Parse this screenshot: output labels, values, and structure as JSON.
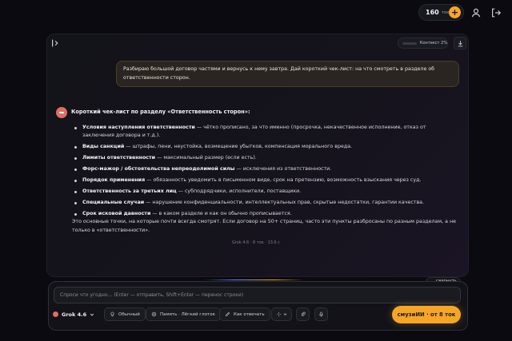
{
  "topbar": {
    "token_count": "160",
    "token_unit": "ток",
    "plus_label": "+"
  },
  "chat": {
    "context_label": "Контекст 2%",
    "user_message": "Разбираю большой договор частями и вернусь к нему завтра. Дай короткий чек-лист: на что смотреть в разделе об ответственности сторон.",
    "answer_title": "Короткий чек-лист по разделу «Ответственность сторон»:",
    "checklist": [
      {
        "term": "Условия наступления ответственности",
        "desc": " — чётко прописано, за что именно (просрочка, некачественное исполнение, отказ от заключения договора и т.д.)."
      },
      {
        "term": "Виды санкций",
        "desc": " — штрафы, пени, неустойка, возмещение убытков, компенсация морального вреда."
      },
      {
        "term": "Лимиты ответственности",
        "desc": " — максимальный размер (если есть)."
      },
      {
        "term": "Форс-мажор / обстоятельства непреодолимой силы",
        "desc": " — исключения из ответственности."
      },
      {
        "term": "Порядок применения",
        "desc": " — обязанность уведомить в письменном виде, срок на претензию, возможность взыскания через суд."
      },
      {
        "term": "Ответственность за третьих лиц",
        "desc": " — субподрядчики, исполнители, поставщики."
      },
      {
        "term": "Специальные случаи",
        "desc": " — нарушение конфиденциальности, интеллектуальных прав, скрытые недостатки, гарантии качества."
      },
      {
        "term": "Срок исковой давности",
        "desc": " — в каком разделе и как он обычно прописывается."
      }
    ],
    "answer_outro": "Это основные точки, на которые почти всегда смотрят. Если договор на 50+ страниц, часто эти пункты разбросаны по разным разделам, а не только в «ответственности».",
    "meta": "Grok 4.6 · 8 ток · 13.6 с",
    "collapse_label": "СВЕРНУТЬ"
  },
  "composer": {
    "placeholder": "Спроси что угодно… (Enter — отправить, Shift+Enter — перенос строки)",
    "value": "",
    "model_label": "Grok 4.6",
    "mode_label": "Обычный",
    "memory_label": "Память · Лёгкий глоток",
    "answer_style_label": "Как отвечать",
    "send_label": "смузиИИ · от 8 ток"
  },
  "colors": {
    "accent": "#f4a62a",
    "assistant_avatar": "#e06d63",
    "user_bubble": "#2a2520"
  }
}
